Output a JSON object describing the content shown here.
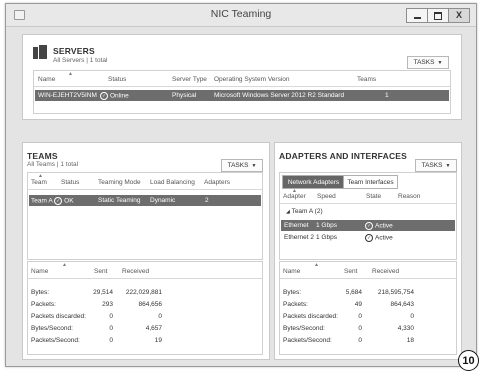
{
  "window": {
    "title": "NIC Teaming"
  },
  "servers": {
    "title": "SERVERS",
    "subtitle": "All Servers | 1 total",
    "tasks_label": "TASKS",
    "columns": [
      "Name",
      "Status",
      "Server Type",
      "Operating System Version",
      "Teams"
    ],
    "rows": [
      {
        "name": "WIN-EJEHT2V5INM",
        "status": "Online",
        "server_type": "Physical",
        "os": "Microsoft Windows Server 2012 R2 Standard",
        "teams": "1"
      }
    ]
  },
  "teams": {
    "title": "TEAMS",
    "subtitle": "All Teams | 1 total",
    "tasks_label": "TASKS",
    "columns": [
      "Team",
      "Status",
      "Teaming Mode",
      "Load Balancing",
      "Adapters"
    ],
    "rows": [
      {
        "team": "Team A",
        "status": "OK",
        "mode": "Static Teaming",
        "lb": "Dynamic",
        "adapters": "2"
      }
    ],
    "stats_columns": [
      "Name",
      "Sent",
      "Received"
    ],
    "stats": [
      {
        "name": "Bytes:",
        "sent": "29,514",
        "received": "222,029,881"
      },
      {
        "name": "Packets:",
        "sent": "293",
        "received": "864,656"
      },
      {
        "name": "Packets discarded:",
        "sent": "0",
        "received": "0"
      },
      {
        "name": "Bytes/Second:",
        "sent": "0",
        "received": "4,657"
      },
      {
        "name": "Packets/Second:",
        "sent": "0",
        "received": "19"
      }
    ]
  },
  "adapters": {
    "title": "ADAPTERS AND INTERFACES",
    "tasks_label": "TASKS",
    "tabs": [
      "Network Adapters",
      "Team Interfaces"
    ],
    "columns": [
      "Adapter",
      "Speed",
      "State",
      "Reason"
    ],
    "group_label": "Team A (2)",
    "rows": [
      {
        "adapter": "Ethernet",
        "speed": "1 Gbps",
        "state": "Active"
      },
      {
        "adapter": "Ethernet 2",
        "speed": "1 Gbps",
        "state": "Active"
      }
    ],
    "stats_columns": [
      "Name",
      "Sent",
      "Received"
    ],
    "stats": [
      {
        "name": "Bytes:",
        "sent": "5,684",
        "received": "218,595,754"
      },
      {
        "name": "Packets:",
        "sent": "49",
        "received": "864,643"
      },
      {
        "name": "Packets discarded:",
        "sent": "0",
        "received": "0"
      },
      {
        "name": "Bytes/Second:",
        "sent": "0",
        "received": "4,330"
      },
      {
        "name": "Packets/Second:",
        "sent": "0",
        "received": "18"
      }
    ]
  },
  "annotation": {
    "step_number": "10"
  },
  "icons": {
    "ok": "check-circle-icon",
    "active": "check-circle-icon",
    "server": "server-icon",
    "expand": "triangle-down-icon"
  }
}
